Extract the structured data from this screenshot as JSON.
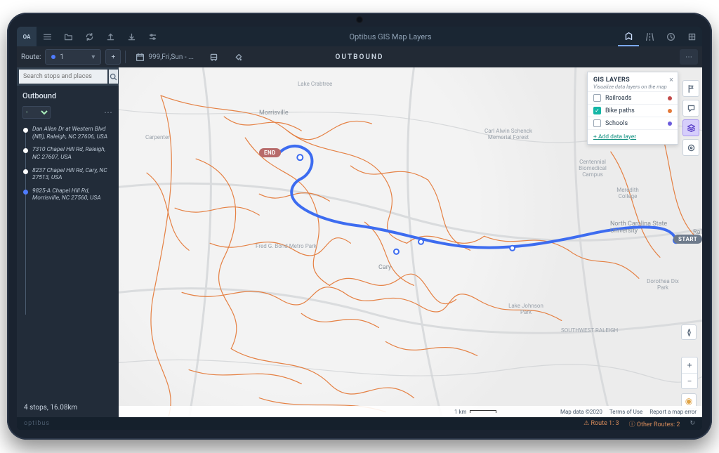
{
  "app": {
    "title": "Optibus GIS Map Layers"
  },
  "menubar": {
    "logo": "OA"
  },
  "toolbar": {
    "route_label": "Route:",
    "route_value": "1",
    "add_label": "+",
    "schedule": "999,Fri,Sun - ...",
    "direction_heading": "OUTBOUND"
  },
  "search": {
    "placeholder": "Search stops and places"
  },
  "panel": {
    "title": "Outbound",
    "variant": "-",
    "stops": [
      "Dan Allen Dr at Western Blvd (NB), Raleigh, NC 27606, USA",
      "7310 Chapel Hill Rd, Raleigh, NC 27607, USA",
      "8237 Chapel Hill Rd, Cary, NC 27513, USA",
      "9825-A Chapel Hill Rd, Morrisville, NC 27560, USA"
    ],
    "summary": "4 stops, 16.08km"
  },
  "gis": {
    "title": "GIS LAYERS",
    "subtitle": "Visualize data layers on the map",
    "layers": [
      {
        "name": "Railroads",
        "checked": false,
        "color": "#c24a4a"
      },
      {
        "name": "Bike paths",
        "checked": true,
        "color": "#e47a3a"
      },
      {
        "name": "Schools",
        "checked": false,
        "color": "#6b5bdc"
      }
    ],
    "add_label": "Add data layer"
  },
  "badges": {
    "start": "START",
    "end": "END"
  },
  "places": {
    "morrisville": "Morrisville",
    "carpenter": "Carpenter",
    "cary": "Cary",
    "raleigh": "Ral",
    "ncsu": "North Carolina State University",
    "meredith": "Meredith College",
    "centennial": "Centennial Biomedical Campus",
    "schenck": "Carl Alwin Schenck Memorial Forest",
    "bond": "Fred G. Bond Metro Park",
    "dix": "Dorothea Dix Park",
    "sw_raleigh": "SOUTHWEST RALEIGH",
    "johnson": "Lake Johnson Park",
    "crabtree": "Lake Crabtree"
  },
  "map_footer": {
    "scale": "1 km",
    "copyright": "Map data ©2020",
    "terms": "Terms of Use",
    "report": "Report a map error"
  },
  "statusbar": {
    "brand": "optibus",
    "route_stat": "Route 1: 3",
    "other_stat": "Other Routes: 2"
  }
}
